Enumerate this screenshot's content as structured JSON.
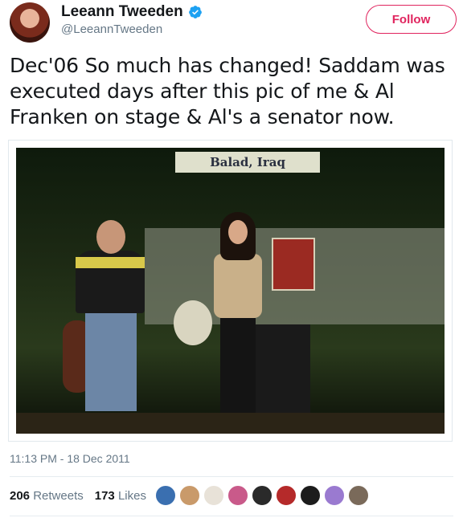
{
  "author": {
    "display_name": "Leeann Tweeden",
    "handle": "@LeeannTweeden",
    "verified": true,
    "verified_icon": "verified-badge-icon"
  },
  "follow_button": {
    "label": "Follow"
  },
  "tweet": {
    "text": "Dec'06 So much has changed! Saddam was executed days after this pic of me & Al Franken on stage & Al's a senator now.",
    "timestamp": "11:13 PM - 18 Dec 2011"
  },
  "photo": {
    "sign_text": "Balad, Iraq"
  },
  "engagement": {
    "retweets_count": "206",
    "retweets_label": "Retweets",
    "likes_count": "173",
    "likes_label": "Likes"
  },
  "likers": [
    {
      "color": "#3a6fb0"
    },
    {
      "color": "#c99a6a"
    },
    {
      "color": "#e8e2d8"
    },
    {
      "color": "#c95a8a"
    },
    {
      "color": "#2a2a2a"
    },
    {
      "color": "#b52a2a"
    },
    {
      "color": "#1c1c1c"
    },
    {
      "color": "#9a7ad0"
    },
    {
      "color": "#7a6a5a"
    }
  ],
  "colors": {
    "accent": "#e0245e",
    "verified": "#1da1f2",
    "secondary_text": "#657786"
  }
}
